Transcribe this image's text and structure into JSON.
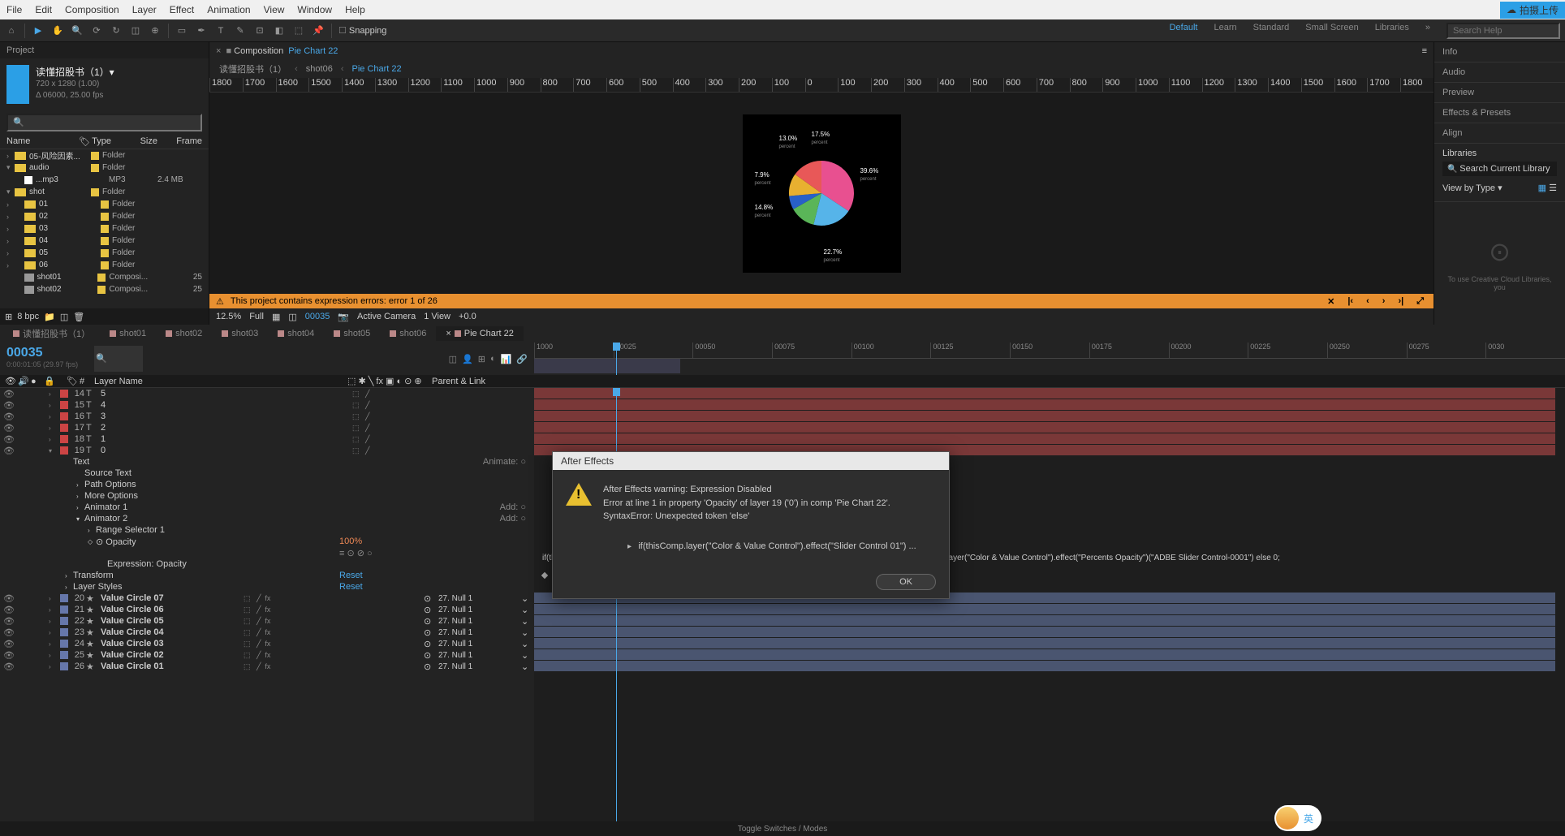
{
  "menubar": [
    "File",
    "Edit",
    "Composition",
    "Layer",
    "Effect",
    "Animation",
    "View",
    "Window",
    "Help"
  ],
  "upload_btn": "拍摄上传",
  "workspaces": {
    "items": [
      "Default",
      "Learn",
      "Standard",
      "Small Screen",
      "Libraries"
    ],
    "active": "Default"
  },
  "search_placeholder": "Search Help",
  "snapping": "Snapping",
  "project": {
    "tab": "Project",
    "title": "读懂招股书（1）▾",
    "res": "720 x 1280 (1.00)",
    "fps": "Δ 06000, 25.00 fps",
    "cols": [
      "Name",
      "Type",
      "Size",
      "Frame"
    ],
    "rows": [
      {
        "tri": "›",
        "icon": "folder",
        "name": "05-风险因素...",
        "label": true,
        "type": "Folder"
      },
      {
        "tri": "▾",
        "icon": "folder",
        "name": "audio",
        "label": true,
        "type": "Folder"
      },
      {
        "tri": "",
        "icon": "file",
        "name": "...mp3",
        "indent": 1,
        "type": "MP3",
        "size": "2.4 MB"
      },
      {
        "tri": "▾",
        "icon": "folder",
        "name": "shot",
        "label": true,
        "type": "Folder"
      },
      {
        "tri": "›",
        "icon": "folder",
        "name": "01",
        "indent": 1,
        "label": true,
        "type": "Folder"
      },
      {
        "tri": "›",
        "icon": "folder",
        "name": "02",
        "indent": 1,
        "label": true,
        "type": "Folder"
      },
      {
        "tri": "›",
        "icon": "folder",
        "name": "03",
        "indent": 1,
        "label": true,
        "type": "Folder"
      },
      {
        "tri": "›",
        "icon": "folder",
        "name": "04",
        "indent": 1,
        "label": true,
        "type": "Folder"
      },
      {
        "tri": "›",
        "icon": "folder",
        "name": "05",
        "indent": 1,
        "label": true,
        "type": "Folder"
      },
      {
        "tri": "›",
        "icon": "folder",
        "name": "06",
        "indent": 1,
        "label": true,
        "type": "Folder"
      },
      {
        "tri": "",
        "icon": "comp",
        "name": "shot01",
        "indent": 1,
        "label": true,
        "type": "Composi...",
        "fr": "25"
      },
      {
        "tri": "",
        "icon": "comp",
        "name": "shot02",
        "indent": 1,
        "label": true,
        "type": "Composi...",
        "fr": "25"
      }
    ],
    "footer_bpc": "8 bpc"
  },
  "comp": {
    "tablabel": "Composition",
    "tabname": "Pie Chart 22",
    "crumbs": [
      "读懂招股书（1）",
      "shot06",
      "Pie Chart 22"
    ],
    "ruler": [
      "1800",
      "1700",
      "1600",
      "1500",
      "1400",
      "1300",
      "1200",
      "1100",
      "1000",
      "900",
      "800",
      "700",
      "600",
      "500",
      "400",
      "300",
      "200",
      "100",
      "0",
      "100",
      "200",
      "300",
      "400",
      "500",
      "600",
      "700",
      "800",
      "900",
      "1000",
      "1100",
      "1200",
      "1300",
      "1400",
      "1500",
      "1600",
      "1700",
      "1800"
    ],
    "error": "This project contains expression errors: error 1 of 26",
    "footer": {
      "zoom": "12.5%",
      "res": "Full",
      "cam": "Active Camera",
      "view": "1 View",
      "exp": "+0.0",
      "time": "00035"
    }
  },
  "right": {
    "panels": [
      "Info",
      "Audio",
      "Preview",
      "Effects & Presets",
      "Align",
      "Libraries"
    ],
    "lib_search": "Search Current Library",
    "view_by": "View by Type ▾",
    "cc_msg": "To use Creative Cloud Libraries, you"
  },
  "timeline": {
    "tabs": [
      {
        "name": "读懂招股书（1）"
      },
      {
        "name": "shot01"
      },
      {
        "name": "shot02"
      },
      {
        "name": "shot03"
      },
      {
        "name": "shot04"
      },
      {
        "name": "shot05"
      },
      {
        "name": "shot06"
      },
      {
        "name": "Pie Chart 22",
        "active": true
      }
    ],
    "timecode": "00035",
    "timecode_sub": "0:00:01:05 (29.97 fps)",
    "ruler": [
      "1000",
      "00025",
      "00050",
      "00075",
      "00100",
      "00125",
      "00150",
      "00175",
      "00200",
      "00225",
      "00250",
      "00275",
      "0030"
    ],
    "cols": {
      "layer": "Layer Name",
      "parent": "Parent & Link"
    },
    "layers": [
      {
        "n": "14",
        "ty": "T",
        "name": "5",
        "lbl": "red"
      },
      {
        "n": "15",
        "ty": "T",
        "name": "4",
        "lbl": "red"
      },
      {
        "n": "16",
        "ty": "T",
        "name": "3",
        "lbl": "red"
      },
      {
        "n": "17",
        "ty": "T",
        "name": "2",
        "lbl": "red"
      },
      {
        "n": "18",
        "ty": "T",
        "name": "1",
        "lbl": "red"
      },
      {
        "n": "19",
        "ty": "T",
        "name": "0",
        "lbl": "red",
        "expanded": true
      }
    ],
    "text_props": [
      {
        "p": "Text",
        "val": "",
        "anim": "Animate: ○"
      },
      {
        "p": "Source Text",
        "ind": 1
      },
      {
        "p": "Path Options",
        "ind": 1,
        "tri": "›"
      },
      {
        "p": "More Options",
        "ind": 1,
        "tri": "›"
      },
      {
        "p": "Animator 1",
        "ind": 1,
        "tri": "›",
        "anim": "Add: ○"
      },
      {
        "p": "Animator 2",
        "ind": 1,
        "tri": "▾",
        "anim": "Add: ○"
      },
      {
        "p": "Range Selector 1",
        "ind": 2,
        "tri": "›"
      },
      {
        "p": "Opacity",
        "ind": 2,
        "kf": true,
        "val": "100%"
      },
      {
        "p": "",
        "ind": 2,
        "expr_icons": true
      },
      {
        "p": "Expression: Opacity",
        "ind": 3
      }
    ],
    "transform": {
      "p": "Transform",
      "val": "Reset"
    },
    "lstyles": {
      "p": "Layer Styles",
      "val": "Reset"
    },
    "value_layers": [
      {
        "n": "20",
        "name": "Value Circle 07",
        "parent": "27. Null 1"
      },
      {
        "n": "21",
        "name": "Value Circle 06",
        "parent": "27. Null 1"
      },
      {
        "n": "22",
        "name": "Value Circle 05",
        "parent": "27. Null 1"
      },
      {
        "n": "23",
        "name": "Value Circle 04",
        "parent": "27. Null 1"
      },
      {
        "n": "24",
        "name": "Value Circle 03",
        "parent": "27. Null 1"
      },
      {
        "n": "25",
        "name": "Value Circle 02",
        "parent": "27. Null 1"
      },
      {
        "n": "26",
        "name": "Value Circle 01",
        "parent": "27. Null 1"
      }
    ],
    "expression": "if(thisComp.layer(\"Color & Value Control\").effect(\"Slider Control 01\")(\"ADBE Slider Control-0001\")>>0) thisComp.layer(\"Color & Value Control\").effect(\"Percents Opacity\")(\"ADBE Slider Control-0001\") else 0;",
    "footer": "Toggle Switches / Modes"
  },
  "dialog": {
    "title": "After Effects",
    "l1": "After Effects warning: Expression Disabled",
    "l2": "Error at line 1 in property 'Opacity' of layer 19 ('0') in comp 'Pie Chart 22'.",
    "l3": "SyntaxError: Unexpected token 'else'",
    "code": "if(thisComp.layer(\"Color & Value Control\").effect(\"Slider Control 01\") ...",
    "ok": "OK"
  },
  "chat": "英",
  "chart_data": {
    "type": "pie",
    "title": "",
    "values": [
      39.6,
      22.7,
      14.8,
      7.9,
      13.0,
      17.5
    ],
    "labels": [
      "39.6%",
      "22.7%",
      "14.8%",
      "7.9%",
      "13.0%",
      "17.5%"
    ],
    "sublabel": "percent",
    "colors": [
      "#e85090",
      "#56b4e9",
      "#5ab558",
      "#2860c8",
      "#e8b030",
      "#e85858"
    ]
  }
}
